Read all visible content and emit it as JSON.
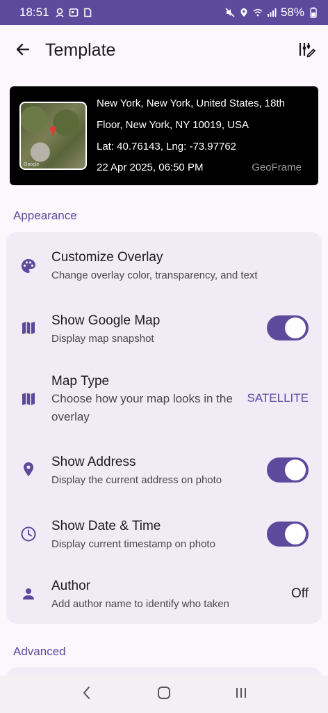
{
  "status_bar": {
    "time": "18:51",
    "battery": "58%",
    "left_icons": [
      "location-id-icon",
      "news-icon",
      "sim-icon"
    ],
    "right_icons": [
      "mute-icon",
      "location-icon",
      "wifi-icon",
      "signal-icon",
      "battery-icon"
    ]
  },
  "app_bar": {
    "title": "Template",
    "back_icon": "arrow-back-icon",
    "action_icon": "tune-icon"
  },
  "preview": {
    "address_line1": "New York, New York, United States, 18th",
    "address_line2": "Floor, New York, NY 10019, USA",
    "coords": "Lat: 40.76143, Lng: -73.97762",
    "datetime": "22 Apr 2025, 06:50 PM",
    "brand": "GeoFrame",
    "map_credit": "Google"
  },
  "sections": {
    "appearance": "Appearance",
    "advanced": "Advanced"
  },
  "settings": {
    "customize_overlay": {
      "title": "Customize Overlay",
      "subtitle": "Change overlay color, transparency, and text",
      "icon": "palette-icon"
    },
    "show_google_map": {
      "title": "Show Google Map",
      "subtitle": "Display map snapshot",
      "icon": "map-icon",
      "enabled": true
    },
    "map_type": {
      "title": "Map Type",
      "subtitle_line1": "Choose how your map looks in the",
      "subtitle_line2": "overlay",
      "value": "SATELLITE",
      "icon": "map-icon"
    },
    "show_address": {
      "title": "Show Address",
      "subtitle": "Display the current address on photo",
      "icon": "location-pin-icon",
      "enabled": true
    },
    "show_date_time": {
      "title": "Show Date & Time",
      "subtitle": "Display current timestamp on photo",
      "icon": "clock-icon",
      "enabled": true
    },
    "author": {
      "title": "Author",
      "subtitle": "Add author name to identify who taken",
      "value": "Off",
      "icon": "person-icon"
    }
  },
  "colors": {
    "accent": "#5d4a9c",
    "background": "#fcf6fd",
    "card": "#f1ebf6"
  }
}
